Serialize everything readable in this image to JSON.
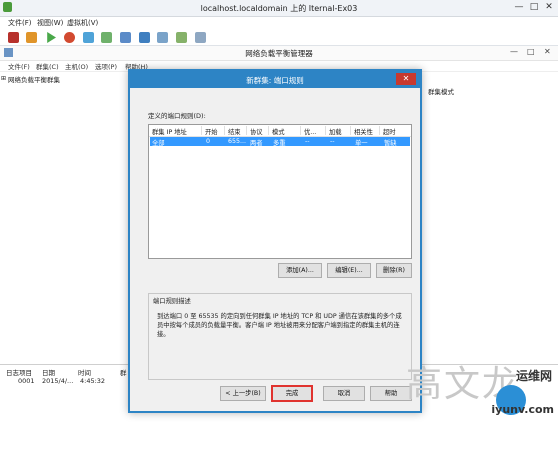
{
  "vm_window": {
    "title": "localhost.localdomain 上的 Iternal-Ex03",
    "menu": [
      "文件(F)",
      "视图(W)",
      "虚拟机(V)"
    ],
    "controls": [
      "—",
      "□",
      "✕"
    ],
    "toolbar_icons": [
      "stop-icon",
      "pause-icon",
      "play-icon",
      "reset-icon",
      "snapshot-icon",
      "revert-icon",
      "manage-icon",
      "console-icon",
      "fullscreen-icon",
      "send-key-icon",
      "settings-icon"
    ]
  },
  "nlb_manager": {
    "title": "网络负载平衡管理器",
    "controls": [
      "—",
      "□",
      "✕"
    ],
    "menu": [
      "文件(F)",
      "群集(C)",
      "主机(O)",
      "选项(P)",
      "帮助(H)"
    ],
    "tree_root": "网络负载平衡群集",
    "right_column_header": "群集模式",
    "log": {
      "headers": [
        "日志项目",
        "日期",
        "时间",
        "群"
      ],
      "rows": [
        [
          "0001",
          "2015/4/...",
          "4:45:32",
          ""
        ]
      ]
    }
  },
  "dialog": {
    "title": "新群集: 端口规则",
    "close_glyph": "✕",
    "rules_label": "定义的端口规则(D):",
    "columns": [
      "群集 IP 地址",
      "开始",
      "结束",
      "协议",
      "模式",
      "优...",
      "加载",
      "相关性",
      "超时"
    ],
    "rules": [
      [
        "全部",
        "0",
        "655...",
        "两者",
        "多重",
        "--",
        "--",
        "单一",
        "暂缺"
      ]
    ],
    "buttons": {
      "add": "添加(A)...",
      "edit": "编辑(E)...",
      "remove": "删除(R)"
    },
    "description_title": "端口规则描述",
    "description": "到达端口 0 至 65535 的定向到任何群集 IP 地址的 TCP 和 UDP 通信在该群集的多个成员中按每个成员的负载量平衡。客户端 IP 地址被用来分配客户端到指定的群集主机的连接。",
    "nav": {
      "back": "< 上一步(B)",
      "finish": "完成",
      "cancel": "取消",
      "help": "帮助"
    }
  },
  "watermark": {
    "chars": "高文龙",
    "site": "运维网",
    "url": "iyunv.com"
  },
  "colors": {
    "accent": "#2d84c5",
    "selection": "#3399ff",
    "close_red": "#c7392f",
    "highlight_border": "#e0332f"
  }
}
